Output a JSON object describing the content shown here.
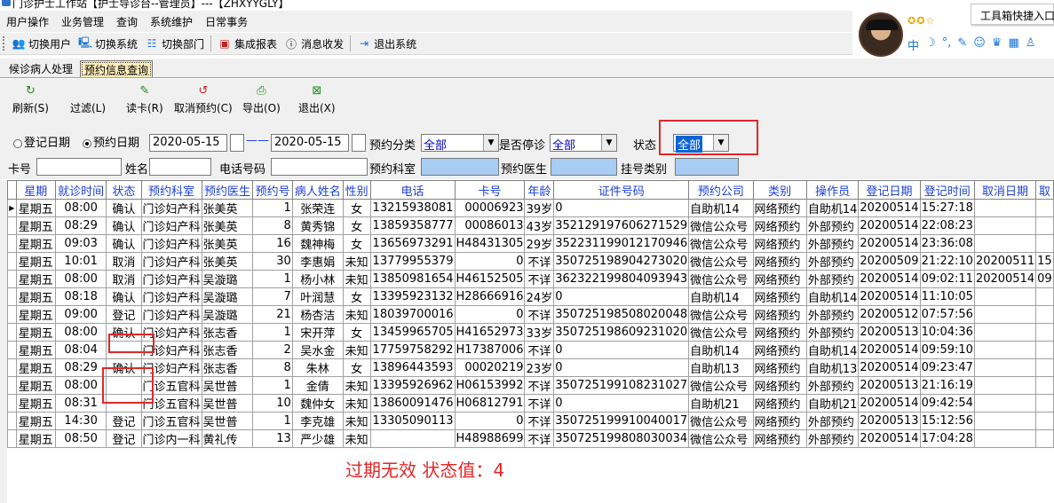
{
  "window": {
    "title": "门诊护士工作站【护士导诊台--管理员】---【ZHXYYGLY】"
  },
  "menu": [
    "用户操作",
    "业务管理",
    "查询",
    "系统维护",
    "日常事务"
  ],
  "toolbar": {
    "switch_user": "切换用户",
    "switch_system": "切换系统",
    "switch_dept": "切换部门",
    "integrated_report": "集成报表",
    "messages": "消息收发",
    "exit_system": "退出系统"
  },
  "tray": {
    "tooltip": "工具箱快捷入口",
    "stars": "✪✪☆",
    "quick_icons": [
      "中",
      "☽",
      "°,",
      "✎",
      "☺",
      "♛",
      "▦",
      "♙"
    ]
  },
  "tabs": [
    {
      "label": "候诊病人处理",
      "active": false
    },
    {
      "label": "预约信息查询",
      "active": true
    }
  ],
  "actions": {
    "refresh": "刷新(S)",
    "filter": "过滤(L)",
    "read_card": "读卡(R)",
    "cancel_booking": "取消预约(C)",
    "export": "导出(O)",
    "exit": "退出(X)"
  },
  "filters": {
    "reg_date_label": "登记日期",
    "appt_date_label": "预约日期",
    "date_from": "2020-05-15",
    "date_sep": "——",
    "date_to": "2020-05-15",
    "category_label": "预约分类",
    "category_value": "全部",
    "stop_label": "是否停诊",
    "stop_value": "全部",
    "status_label": "状态",
    "status_value": "全部",
    "card_label": "卡号",
    "name_label": "姓名",
    "phone_label": "电话号码",
    "dept_label": "预约科室",
    "doctor_label": "预约医生",
    "regtype_label": "挂号类别"
  },
  "grid": {
    "columns": [
      "星期",
      "就诊时间",
      "状态",
      "预约科室",
      "预约医生",
      "预约号",
      "病人姓名",
      "性别",
      "电话",
      "卡号",
      "年龄",
      "证件号码",
      "预约公司",
      "类别",
      "操作员",
      "登记日期",
      "登记时间",
      "取消日期",
      "取"
    ],
    "rows": [
      [
        "星期五",
        "08:00",
        "确认",
        "门诊妇产科",
        "张美英",
        "1",
        "张荣连",
        "女",
        "13215938081",
        "00006923",
        "39岁",
        "0",
        "自助机14",
        "网络预约",
        "自助机14",
        "20200514",
        "15:27:18",
        "",
        ""
      ],
      [
        "星期五",
        "08:29",
        "确认",
        "门诊妇产科",
        "张美英",
        "8",
        "黄秀锦",
        "女",
        "13859358777",
        "00086013",
        "43岁",
        "352129197606271529",
        "微信公众号",
        "网络预约",
        "外部预约",
        "20200514",
        "22:08:23",
        "",
        ""
      ],
      [
        "星期五",
        "09:03",
        "确认",
        "门诊妇产科",
        "张美英",
        "16",
        "魏神梅",
        "女",
        "13656973291",
        "H48431305",
        "29岁",
        "352231199012170946",
        "微信公众号",
        "网络预约",
        "外部预约",
        "20200514",
        "23:36:08",
        "",
        ""
      ],
      [
        "星期五",
        "10:01",
        "取消",
        "门诊妇产科",
        "张美英",
        "30",
        "李惠娟",
        "未知",
        "13779955379",
        "0",
        "不详",
        "350725198904273020",
        "微信公众号",
        "网络预约",
        "外部预约",
        "20200509",
        "21:22:10",
        "20200511",
        "15"
      ],
      [
        "星期五",
        "08:00",
        "取消",
        "门诊妇产科",
        "吴漩璐",
        "1",
        "杨小林",
        "未知",
        "13850981654",
        "H46152505",
        "不详",
        "362322199804093943",
        "微信公众号",
        "网络预约",
        "外部预约",
        "20200514",
        "09:02:11",
        "20200514",
        "09"
      ],
      [
        "星期五",
        "08:18",
        "确认",
        "门诊妇产科",
        "吴漩璐",
        "7",
        "叶润慧",
        "女",
        "13395923132",
        "H28666916",
        "24岁",
        "0",
        "自助机14",
        "网络预约",
        "自助机14",
        "20200514",
        "11:10:05",
        "",
        ""
      ],
      [
        "星期五",
        "09:00",
        "登记",
        "门诊妇产科",
        "吴漩璐",
        "21",
        "杨杏洁",
        "未知",
        "18039700016",
        "0",
        "不详",
        "350725198508020048",
        "微信公众号",
        "网络预约",
        "外部预约",
        "20200512",
        "07:57:56",
        "",
        ""
      ],
      [
        "星期五",
        "08:00",
        "确认",
        "门诊妇产科",
        "张志香",
        "1",
        "宋开萍",
        "女",
        "13459965705",
        "H41652973",
        "33岁",
        "350725198609231020",
        "微信公众号",
        "网络预约",
        "外部预约",
        "20200513",
        "10:04:36",
        "",
        ""
      ],
      [
        "星期五",
        "08:04",
        "",
        "门诊妇产科",
        "张志香",
        "2",
        "吴水金",
        "未知",
        "17759758292",
        "H17387006",
        "不详",
        "0",
        "自助机14",
        "网络预约",
        "自助机14",
        "20200514",
        "09:59:10",
        "",
        ""
      ],
      [
        "星期五",
        "08:29",
        "确认",
        "门诊妇产科",
        "张志香",
        "8",
        "朱林",
        "女",
        "13896443593",
        "00020219",
        "23岁",
        "0",
        "自助机13",
        "网络预约",
        "自助机13",
        "20200514",
        "09:23:47",
        "",
        ""
      ],
      [
        "星期五",
        "08:00",
        "",
        "门诊五官科",
        "吴世普",
        "1",
        "金倩",
        "未知",
        "13395926962",
        "H06153992",
        "不详",
        "350725199108231027",
        "微信公众号",
        "网络预约",
        "外部预约",
        "20200513",
        "21:16:19",
        "",
        ""
      ],
      [
        "星期五",
        "08:31",
        "",
        "门诊五官科",
        "吴世普",
        "10",
        "魏仲女",
        "未知",
        "13860091476",
        "H06812791",
        "不详",
        "0",
        "自助机21",
        "网络预约",
        "自助机21",
        "20200514",
        "09:42:54",
        "",
        ""
      ],
      [
        "星期五",
        "14:30",
        "登记",
        "门诊五官科",
        "吴世普",
        "1",
        "李克雄",
        "未知",
        "13305090113",
        "0",
        "不详",
        "350725199910040017",
        "微信公众号",
        "网络预约",
        "外部预约",
        "20200513",
        "15:12:56",
        "",
        ""
      ],
      [
        "星期五",
        "08:50",
        "登记",
        "门诊内一科",
        "黄礼传",
        "13",
        "严少雄",
        "未知",
        "",
        "H48988699",
        "不详",
        "350725199808030034",
        "微信公众号",
        "网络预约",
        "外部预约",
        "20200514",
        "17:04:28",
        "",
        ""
      ]
    ]
  },
  "annotation": "过期无效 状态值：4"
}
